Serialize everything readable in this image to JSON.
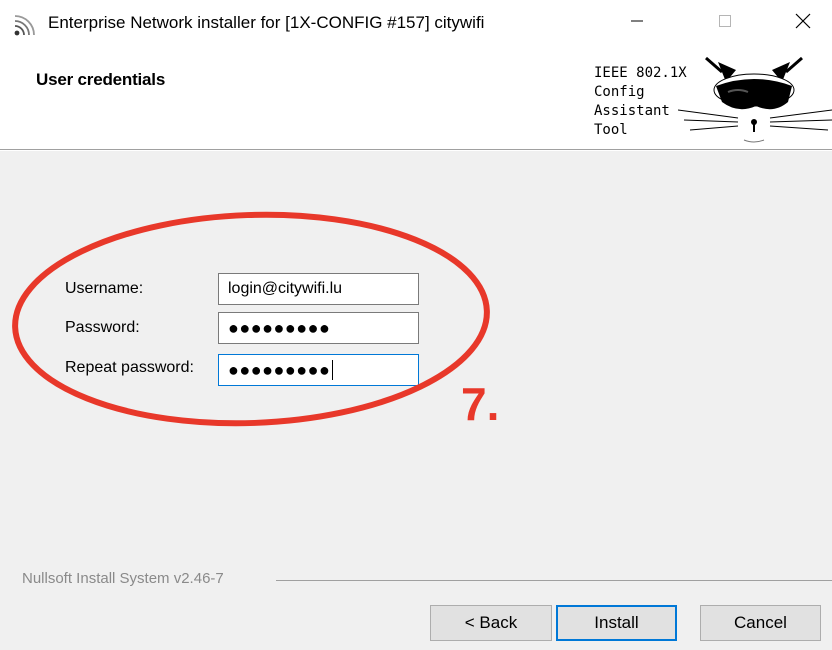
{
  "window": {
    "title": "Enterprise Network installer for [1X-CONFIG #157] citywifi",
    "app_icon": "wifi-icon",
    "controls": {
      "minimize": "minimize-icon",
      "maximize": "maximize-icon",
      "close": "close-icon"
    }
  },
  "header": {
    "title": "User credentials",
    "brand_text": "IEEE 802.1X\nConfig\nAssistant\nTool",
    "logo_icon": "cat-logo-icon"
  },
  "form": {
    "username_label": "Username:",
    "username_value": "login@citywifi.lu",
    "password_label": "Password:",
    "password_value": "●●●●●●●●●",
    "repeat_label": "Repeat password:",
    "repeat_value": "●●●●●●●●●"
  },
  "annotation": {
    "step": "7.",
    "color": "#e8382a"
  },
  "footer": {
    "system_text": "Nullsoft Install System v2.46-7",
    "back_label": "< Back",
    "install_label": "Install",
    "cancel_label": "Cancel"
  },
  "colors": {
    "accent": "#0078d7",
    "panel": "#f0f0f0"
  }
}
